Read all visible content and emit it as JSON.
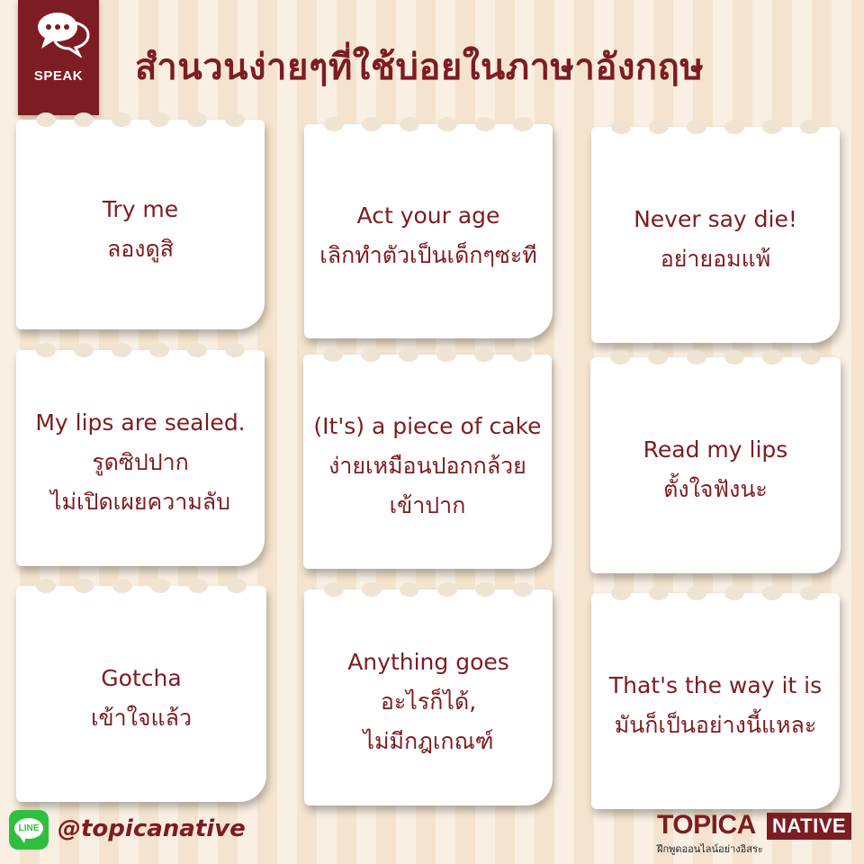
{
  "header": {
    "badge_label": "SPEAK",
    "badge_icon": "speech-bubbles-icon",
    "title": "สำนวนง่ายๆที่ใช้บ่อยในภาษาอังกฤษ"
  },
  "cards": [
    {
      "lines": [
        "Try me",
        "ลองดูสิ"
      ]
    },
    {
      "lines": [
        "Act your age",
        "เลิกทำตัวเป็นเด็กๆซะที"
      ]
    },
    {
      "lines": [
        "Never say die!",
        "อย่ายอมแพ้"
      ]
    },
    {
      "lines": [
        "My lips are sealed.",
        "รูดซิปปาก",
        "ไม่เปิดเผยความลับ"
      ]
    },
    {
      "lines": [
        "(It's) a piece of cake",
        "ง่ายเหมือนปอกกล้วย",
        "เข้าปาก"
      ]
    },
    {
      "lines": [
        "Read my lips",
        "ตั้งใจฟังนะ"
      ]
    },
    {
      "lines": [
        "Gotcha",
        "เข้าใจแล้ว"
      ]
    },
    {
      "lines": [
        "Anything goes",
        "อะไรก็ได้,",
        "ไม่มีกฎเกณฑ์"
      ]
    },
    {
      "lines": [
        "That's the way it is",
        "มันก็เป็นอย่างนี้แหละ"
      ]
    }
  ],
  "footer": {
    "line_icon_label": "LINE",
    "handle": "@topicanative",
    "logo_topica": "TOPICA",
    "logo_native": "NATIVE",
    "logo_tagline": "ฝึกพูดออนไลน์อย่างอิสระ"
  },
  "colors": {
    "brand": "#7d1c22",
    "background": "#f9efe2",
    "line_green": "#2fbf3f"
  }
}
